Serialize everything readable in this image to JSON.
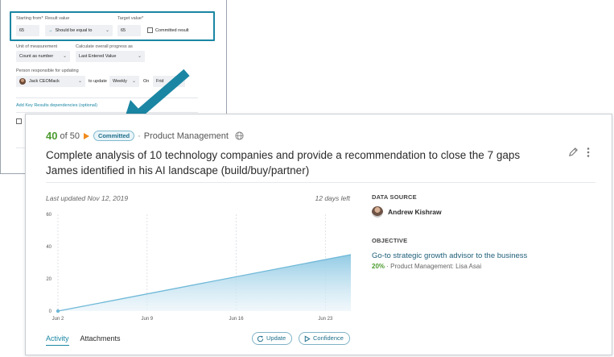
{
  "form": {
    "starting_from_label": "Starting from*",
    "starting_from_value": "65",
    "result_value_label": "Result value",
    "result_value_select": "Should be equal to",
    "target_value_label": "Target value*",
    "target_value": "65",
    "committed_result_label": "Committed result",
    "unit_label": "Unit of measurement",
    "unit_value": "Count as number",
    "progress_label": "Calculate overall progress as",
    "progress_value": "Last Entered Value",
    "responsible_label": "Person responsible for updating",
    "responsible_person": "Jack CEOMack",
    "to_update_text": "to update",
    "frequency": "Weekly",
    "on_text": "On",
    "day": "Frid",
    "add_dependencies_link": "Add Key Results dependencies (optional)"
  },
  "card": {
    "score": "40",
    "score_of": "of 50",
    "status_badge": "Committed",
    "separator": "·",
    "team": "Product Management",
    "title": "Complete analysis of 10 technology companies and provide a recommendation to close the 7 gaps James identified in his AI landscape (build/buy/partner)",
    "last_updated": "Last updated Nov 12, 2019",
    "days_left": "12 days left",
    "tabs": [
      {
        "label": "Activity",
        "active": true
      },
      {
        "label": "Attachments",
        "active": false
      }
    ],
    "update_button": "Update",
    "confidence_button": "Confidence",
    "data_source_label": "DATA SOURCE",
    "data_source_person": "Andrew Kishraw",
    "objective_label": "OBJECTIVE",
    "objective_title": "Go-to strategic growth advisor to the business",
    "objective_percent": "20%",
    "objective_owner": "Product Management: Lisa Asai"
  },
  "chart_data": {
    "type": "area",
    "x": [
      "Jun 2",
      "Jun 25"
    ],
    "values": [
      0,
      35
    ],
    "x_ticks": [
      "Jun 2",
      "Jun 9",
      "Jun 16",
      "Jun 23"
    ],
    "y_ticks": [
      0,
      20,
      40,
      60
    ],
    "ylim": [
      0,
      60
    ],
    "grid": "vertical dashed",
    "color": "#6fb8d8"
  },
  "colors": {
    "accent": "#1a86a3",
    "score_green": "#4c9b2f",
    "status_orange": "#f08a1c"
  },
  "icons": {
    "globe": "globe-icon",
    "pencil": "pencil-icon",
    "kebab": "kebab-menu-icon",
    "arrow": "pointer-arrow-icon"
  }
}
